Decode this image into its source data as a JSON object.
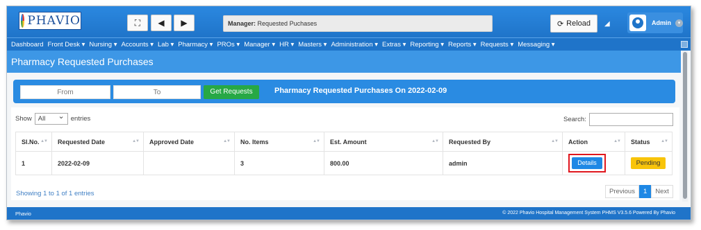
{
  "header": {
    "logo_text": "PHAVIO",
    "manager_label": "Manager:",
    "manager_value": "Requested Puchases",
    "reload_label": "Reload",
    "user_name": "Admin"
  },
  "nav": {
    "items": [
      "Dashboard",
      "Front Desk ▾",
      "Nursing ▾",
      "Accounts ▾",
      "Lab ▾",
      "Pharmacy ▾",
      "PROs ▾",
      "Manager ▾",
      "HR ▾",
      "Masters ▾",
      "Administration ▾",
      "Extras ▾",
      "Reporting ▾",
      "Reports ▾",
      "Requests ▾",
      "Messaging ▾"
    ]
  },
  "page": {
    "title": "Pharmacy Requested Purchases"
  },
  "filter": {
    "from_placeholder": "From",
    "to_placeholder": "To",
    "get_button": "Get Requests",
    "heading": "Pharmacy Requested Purchases On 2022-02-09"
  },
  "table_controls": {
    "show_label": "Show",
    "entries_select": "All",
    "entries_label": "entries",
    "search_label": "Search:"
  },
  "table": {
    "columns": [
      "Sl.No.",
      "Requested Date",
      "Approved Date",
      "No. Items",
      "Est. Amount",
      "Requested By",
      "Action",
      "Status"
    ],
    "rows": [
      {
        "sl": "1",
        "requested_date": "2022-02-09",
        "approved_date": "",
        "items": "3",
        "amount": "800.00",
        "requested_by": "admin",
        "action": "Details",
        "status": "Pending"
      }
    ]
  },
  "pagination": {
    "info": "Showing 1 to 1 of 1 entries",
    "previous": "Previous",
    "current": "1",
    "next": "Next"
  },
  "footer": {
    "left": "Phavio",
    "right": "© 2022 Phavio Hospital Management System PHMS V3.5.6 Powered By Phavio"
  },
  "colors": {
    "primary": "#1f74c9",
    "accent_blue": "#1e88e5",
    "success": "#27a845",
    "warning": "#f8c40a",
    "highlight": "#e0161d"
  }
}
